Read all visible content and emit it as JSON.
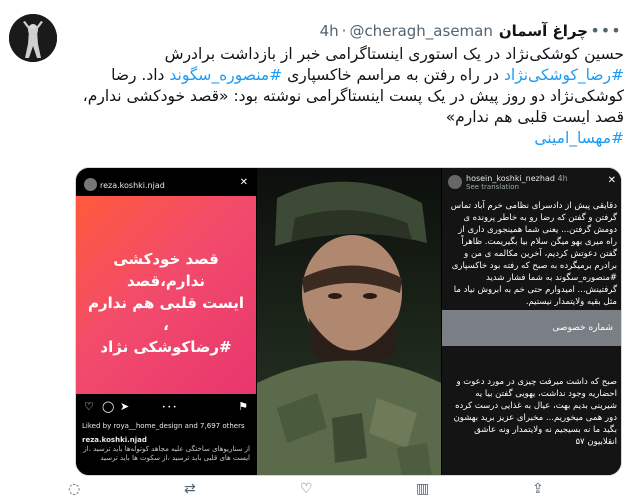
{
  "tweet": {
    "display_name": "چراغ آسمان",
    "handle": "@cheragh_aseman",
    "dot": "·",
    "time": "4h",
    "more_icon": "ellipsis-icon",
    "text_lines": [
      {
        "parts": [
          {
            "t": "حسین کوشکی‌نژاد در یک استوری اینستاگرامی خبر از بازداشت برادرش",
            "tag": false
          }
        ]
      },
      {
        "parts": [
          {
            "t": "#رضا_کوشکی‌نژاد",
            "tag": true
          },
          {
            "t": " در راه رفتن به مراسم خاکسپاری ",
            "tag": false
          },
          {
            "t": "#منصوره_سگوند",
            "tag": true
          },
          {
            "t": " داد. رضا",
            "tag": false
          }
        ]
      },
      {
        "parts": [
          {
            "t": "کوشکی‌نژاد دو روز پیش در یک پست اینستاگرامی نوشته بود: «قصد خودکشی ندارم،",
            "tag": false
          }
        ]
      },
      {
        "parts": [
          {
            "t": "قصد ایست قلبی هم ندارم»",
            "tag": false
          }
        ]
      },
      {
        "parts": [
          {
            "t": "#مهسا_امینی",
            "tag": true
          }
        ]
      }
    ]
  },
  "media": {
    "left": {
      "username": "reza.koshki.njad",
      "close": "✕",
      "post_text_lines": [
        "قصد خودکشی ندارم،قصد",
        "ایست قلبی هم ندارم ،",
        "#رضاکوشکی نژاد"
      ],
      "liked_by": "Liked by roya__home_design and 7,697 others",
      "caption_user": "reza.koshki.njad",
      "caption": "از سناریوهای ساختگی علیه مجاهد کوتوله‌ها باید ترسید ،از ایست های قلبی باید ترسید ،از سکوت ها باید ترسید"
    },
    "right": {
      "username": "hosein_koshki_nezhad",
      "time_badge": "4h",
      "see_translation": "See translation",
      "close": "✕",
      "text_top": "دقایقی پیش از دادسرای نظامی خرم آباد تماس گرفتن و گفتن که رضا رو به خاطر پرونده ی دومش گرفتن... یعنی شما همینجوری داری از راه میری بهو میگن سلام بیا بگیریمت. ظاهراً گفتن دعوتش کردیم، آخرین مکالمه ی من و برادرم برمیگرده به صبح که رفته بود خاکسپاری #منصوره_سگوند به شما فشار شدید گرفتینش... امیدوارم حتی خم به ابروش نیاد ما مثل بقیه ولایتمدار نیستیم.",
      "band_label": "شماره خصوصی",
      "text_bottom": "صبح که داشت میرفت چیزی در مورد دعوت و احضاریه وجود نداشت، یهویی گفتن بیا یه شیرینی بدیم بهت، عیال به غذایی درست کرده دور همی میخوریم... مخبرای عزیز برید بهشون بگید ما نه بسیجیم نه ولایتمدار ونه عاشق انقلابیون ۵۷"
    }
  },
  "actions": {
    "reply_icon": "reply-icon",
    "retweet_icon": "retweet-icon",
    "like_icon": "like-icon",
    "views_icon": "views-icon",
    "share_icon": "share-icon"
  },
  "colors": {
    "link": "#1d9bf0",
    "muted": "#536471",
    "text": "#0f1419",
    "post_red": "#f24b6b"
  }
}
